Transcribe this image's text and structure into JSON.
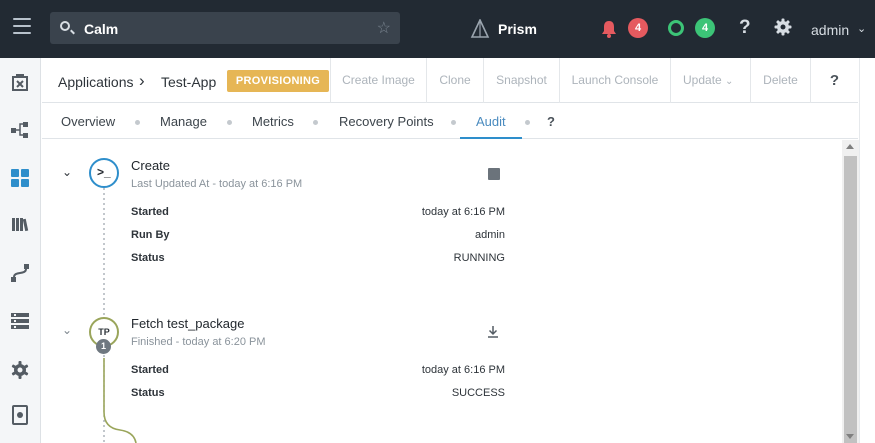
{
  "topbar": {
    "search_value": "Calm",
    "brand": "Prism",
    "alerts_count": "4",
    "tasks_count": "4",
    "help": "?",
    "user": "admin",
    "colors": {
      "bg": "#222a33",
      "alert": "#e55a5f",
      "ok": "#3cc477"
    }
  },
  "sidebar": {
    "icons": [
      "marketplace-icon",
      "blueprints-icon",
      "applications-icon",
      "library-icon",
      "runbooks-icon",
      "endpoints-icon",
      "settings-icon",
      "policies-icon"
    ]
  },
  "header": {
    "breadcrumb_root": "Applications",
    "breadcrumb_sep": "›",
    "app_name": "Test-App",
    "status": "PROVISIONING",
    "actions": [
      "Create Image",
      "Clone",
      "Snapshot",
      "Launch Console",
      "Update",
      "Delete"
    ],
    "help": "?",
    "status_color": "#e6b655"
  },
  "tabs": {
    "items": [
      "Overview",
      "Manage",
      "Metrics",
      "Recovery Points",
      "Audit"
    ],
    "active": "Audit",
    "help": "?"
  },
  "audit": {
    "steps": [
      {
        "title": "Create",
        "subtitle": "Last Updated At - today at 6:16 PM",
        "icon": "terminal-icon",
        "action_icon": "stop-icon",
        "fields": [
          {
            "label": "Started",
            "value": "today at 6:16 PM"
          },
          {
            "label": "Run By",
            "value": "admin"
          },
          {
            "label": "Status",
            "value": "RUNNING"
          }
        ]
      },
      {
        "title": "Fetch test_package",
        "subtitle": "Finished - today at 6:20 PM",
        "icon_text": "TP",
        "icon_badge": "1",
        "action_icon": "download-icon",
        "fields": [
          {
            "label": "Started",
            "value": "today at 6:16 PM"
          },
          {
            "label": "Status",
            "value": "SUCCESS"
          }
        ]
      }
    ]
  }
}
